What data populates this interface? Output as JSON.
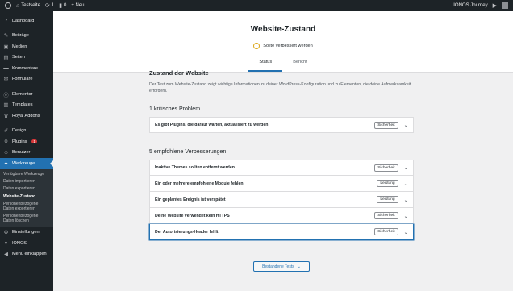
{
  "adminbar": {
    "site_name": "Testseite",
    "updates_count": "1",
    "comments_count": "0",
    "new_label": "+ Neu",
    "account_label": "IONOS Journey"
  },
  "sidebar": {
    "items_top": [
      {
        "label": "Dashboard",
        "icon": "dashboard-icon",
        "glyph": "◔"
      }
    ],
    "items_content": [
      {
        "label": "Beiträge",
        "icon": "pin-icon",
        "glyph": "✎"
      },
      {
        "label": "Medien",
        "icon": "media-icon",
        "glyph": "▣"
      },
      {
        "label": "Seiten",
        "icon": "pages-icon",
        "glyph": "▤"
      },
      {
        "label": "Kommentare",
        "icon": "comments-icon",
        "glyph": "▬"
      },
      {
        "label": "Formulare",
        "icon": "forms-icon",
        "glyph": "✉"
      }
    ],
    "items_builder": [
      {
        "label": "Elementor",
        "icon": "elementor-icon",
        "glyph": "ⓔ"
      },
      {
        "label": "Templates",
        "icon": "templates-icon",
        "glyph": "▥"
      },
      {
        "label": "Royal Addons",
        "icon": "crown-icon",
        "glyph": "♛"
      }
    ],
    "items_system": [
      {
        "label": "Design",
        "icon": "brush-icon",
        "glyph": "✐"
      },
      {
        "label": "Plugins",
        "icon": "plugin-icon",
        "glyph": "⚲",
        "badge": "1"
      },
      {
        "label": "Benutzer",
        "icon": "users-icon",
        "glyph": "☺"
      }
    ],
    "active_item": {
      "label": "Werkzeuge",
      "icon": "wrench-icon",
      "glyph": "✦"
    },
    "submenu": [
      {
        "label": "Verfügbare Werkzeuge",
        "current": false
      },
      {
        "label": "Daten importieren",
        "current": false
      },
      {
        "label": "Daten exportieren",
        "current": false
      },
      {
        "label": "Website-Zustand",
        "current": true
      },
      {
        "label": "Personenbezogene Daten exportieren",
        "current": false
      },
      {
        "label": "Personenbezogene Daten löschen",
        "current": false
      }
    ],
    "items_bottom": [
      {
        "label": "Einstellungen",
        "icon": "settings-icon",
        "glyph": "⚙"
      },
      {
        "label": "IONOS",
        "icon": "ionos-icon",
        "glyph": "●"
      },
      {
        "label": "Menü einklappen",
        "icon": "collapse-icon",
        "glyph": "◀"
      }
    ]
  },
  "header": {
    "title": "Website-Zustand",
    "status_text": "Sollte verbessert werden",
    "status_color": "#dba617",
    "tabs": [
      {
        "label": "Status",
        "active": true
      },
      {
        "label": "Bericht",
        "active": false
      }
    ]
  },
  "main": {
    "section_title": "Zustand der Website",
    "intro": "Der Test zum Website-Zustand zeigt wichtige Informationen zu deiner WordPress-Konfiguration und zu Elementen, die deine Aufmerksamkeit erfordern.",
    "critical_heading": "1 kritisches Problem",
    "critical_issues": [
      {
        "label": "Es gibt Plugins, die darauf warten, aktualisiert zu werden",
        "tag": "Sicherheit"
      }
    ],
    "recommended_heading": "5 empfohlene Verbesserungen",
    "recommended_issues": [
      {
        "label": "Inaktive Themes sollten entfernt werden",
        "tag": "Sicherheit"
      },
      {
        "label": "Ein oder mehrere empfohlene Module fehlen",
        "tag": "Leistung"
      },
      {
        "label": "Ein geplantes Ereignis ist verspätet",
        "tag": "Leistung"
      },
      {
        "label": "Deine Website verwendet kein HTTPS",
        "tag": "Sicherheit"
      },
      {
        "label": "Der Autorisierungs-Header fehlt",
        "tag": "Sicherheit",
        "focused": true
      }
    ],
    "passed_button": "Bestandene Tests"
  }
}
